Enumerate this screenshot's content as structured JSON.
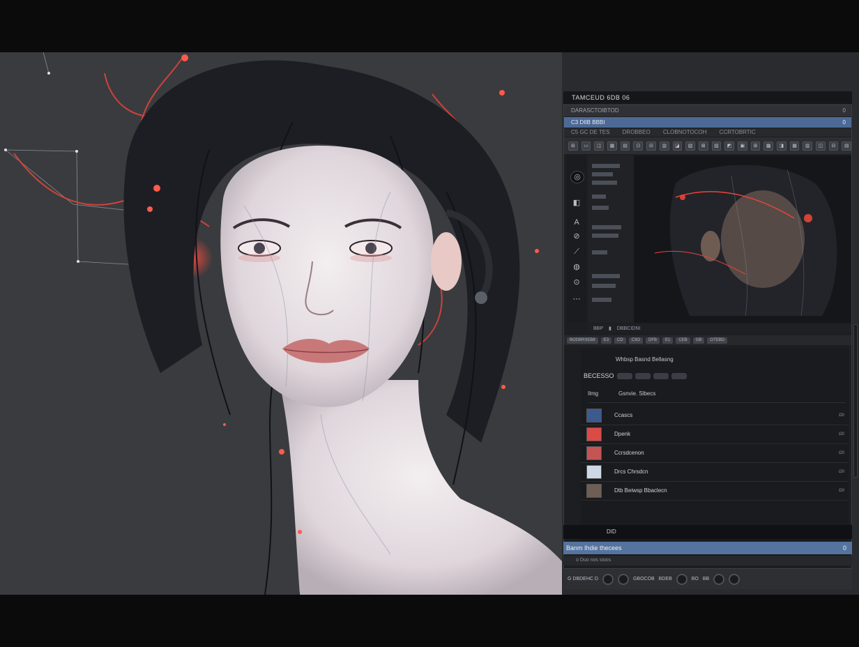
{
  "panel": {
    "title": "TAMCEUD 6DB 06",
    "tab_label": "DARASCTOIBTOD",
    "tab_count": "0",
    "doc_label": "C3 DIIB BBBI",
    "doc_count": "0",
    "menu_items": [
      "C5 GC DE TES",
      "DROBBEO",
      "CLOBNOTOCOH",
      "CCRTOBRTIC"
    ],
    "toolbar_buttons": [
      "⊞",
      "▭",
      "◫",
      "▦",
      "▤",
      "⊡",
      "⊟",
      "▥",
      "◪",
      "▧",
      "⊠",
      "▨",
      "◩",
      "▣",
      "⊞",
      "▩",
      "◨",
      "▦",
      "▥",
      "◫",
      "⊟",
      "▤"
    ],
    "tools": [
      "◎",
      "◧",
      "A",
      "⊘",
      "⟋",
      "◍",
      "⊙",
      "⋯"
    ],
    "timeline_labels": [
      "BBP",
      "▮",
      "DBBCIDNI"
    ],
    "status_buttons": [
      "BODBRSEB8",
      "E3",
      "CD",
      "C3O",
      "DFB",
      "E1",
      "CEB",
      "GB",
      "OTEBD"
    ]
  },
  "layers": {
    "header": "Whbsp Basnd Bellasng",
    "blend_label": "BECESSO",
    "col_1": "Ilmg",
    "col_2": "Gsnvie. Slbecs",
    "rows": [
      {
        "name": "Ccascs",
        "color": "#3d5a8f",
        "value": "Ω0"
      },
      {
        "name": "Dpenk",
        "color": "#dc4a46",
        "value": "Ω0"
      },
      {
        "name": "Ccrsdcenon",
        "color": "#c55454",
        "value": "Ω0"
      },
      {
        "name": "Drcs Chrsdcn",
        "color": "#cfd9e6",
        "value": "Ω0"
      },
      {
        "name": "Dtb Beiwsp Bbaclecn",
        "color": "#6e5e55",
        "value": "Ω0"
      }
    ]
  },
  "second_panel": {
    "title": "DID",
    "bar_label": "Banm Ihdie thecees",
    "bar_count": "0",
    "sub_label": "o  Duo nos sioos",
    "transport_labels": [
      "G DBDEHC D",
      "GBOCOB",
      "BDEB",
      "BO",
      "BB"
    ]
  },
  "colors": {
    "canvas_bg": "#3a3b3f",
    "accent_blue": "#4d6a96",
    "accent_red": "#e84a3a",
    "panel_bg": "#2a2b2e"
  }
}
